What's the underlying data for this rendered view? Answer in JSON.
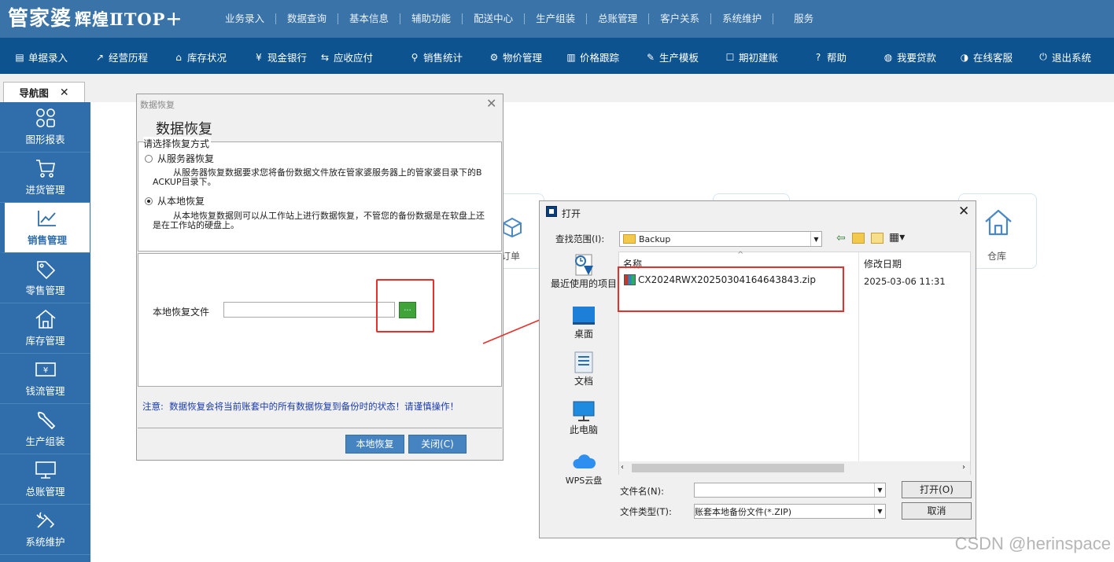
{
  "app": {
    "logo_main": "管家婆",
    "logo_sub": "辉煌ⅡTOP＋"
  },
  "top_menu": [
    "业务录入",
    "数据查询",
    "基本信息",
    "辅助功能",
    "配送中心",
    "生产组装",
    "总账管理",
    "客户关系",
    "系统维护",
    "服务"
  ],
  "toolbar": [
    {
      "label": "单据录入",
      "icon": "document-icon",
      "glyph": "▤"
    },
    {
      "label": "经营历程",
      "icon": "chart-line-icon",
      "glyph": "↗"
    },
    {
      "label": "库存状况",
      "icon": "home-icon",
      "glyph": "⌂"
    },
    {
      "label": "现金银行",
      "icon": "yen-icon",
      "glyph": "¥"
    },
    {
      "label": "应收应付",
      "icon": "exchange-icon",
      "glyph": "⇆"
    },
    {
      "label": "销售统计",
      "icon": "search-icon",
      "glyph": "⚲"
    },
    {
      "label": "物价管理",
      "icon": "gear-icon",
      "glyph": "⚙"
    },
    {
      "label": "价格跟踪",
      "icon": "bar-chart-icon",
      "glyph": "▥"
    },
    {
      "label": "生产模板",
      "icon": "wrench-icon",
      "glyph": "✎"
    },
    {
      "label": "期初建账",
      "icon": "edit-icon",
      "glyph": "☐"
    },
    {
      "label": "帮助",
      "icon": "help-icon",
      "glyph": "?"
    },
    {
      "label": "我要贷款",
      "icon": "moneybag-icon",
      "glyph": "◍"
    },
    {
      "label": "在线客服",
      "icon": "headset-icon",
      "glyph": "◑"
    },
    {
      "label": "退出系统",
      "icon": "power-icon",
      "glyph": "⏻"
    }
  ],
  "nav_tab": {
    "label": "导航图",
    "close": "✕"
  },
  "sidebar": [
    {
      "label": "图形报表",
      "icon": "grid-icon"
    },
    {
      "label": "进货管理",
      "icon": "cart-icon"
    },
    {
      "label": "销售管理",
      "icon": "trend-icon",
      "active": true
    },
    {
      "label": "零售管理",
      "icon": "tag-icon"
    },
    {
      "label": "库存管理",
      "icon": "warehouse-icon"
    },
    {
      "label": "钱流管理",
      "icon": "money-icon"
    },
    {
      "label": "生产组装",
      "icon": "wrench-icon"
    },
    {
      "label": "总账管理",
      "icon": "monitor-icon"
    },
    {
      "label": "系统维护",
      "icon": "tools-icon"
    }
  ],
  "bg_cards": {
    "order_label": "订单",
    "warehouse_label": "仓库"
  },
  "restore_dialog": {
    "window_title": "数据恢复",
    "heading": "数据恢复",
    "group_label": "请选择恢复方式",
    "options": [
      {
        "label": "从服务器恢复",
        "desc": "从服务器恢复数据要求您将备份数据文件放在管家婆服务器上的管家婆目录下的BACKUP目录下。",
        "checked": false
      },
      {
        "label": "从本地恢复",
        "desc": "从本地恢复数据则可以从工作站上进行数据恢复，不管您的备份数据是在软盘上还是在工作站的硬盘上。",
        "checked": true
      }
    ],
    "file_label": "本地恢复文件",
    "file_value": "",
    "browse_label": "...",
    "notice": "注意:  数据恢复会将当前账套中的所有数据恢复到备份时的状态！请谨慎操作！",
    "restore_button": "本地恢复",
    "close_button": "关闭(C)"
  },
  "open_dialog": {
    "title": "打开",
    "lookin_label": "查找范围(I):",
    "lookin_value": "Backup",
    "places": [
      {
        "label": "最近使用的项目",
        "icon": "recent-icon"
      },
      {
        "label": "桌面",
        "icon": "desktop-icon"
      },
      {
        "label": "文档",
        "icon": "documents-icon"
      },
      {
        "label": "此电脑",
        "icon": "computer-icon"
      },
      {
        "label": "WPS云盘",
        "icon": "cloud-icon"
      }
    ],
    "col_name": "名称",
    "col_date": "修改日期",
    "files": [
      {
        "name": "CX2024RWX20250304164643843.zip",
        "date": "2025-03-06 11:31"
      }
    ],
    "filename_label": "文件名(N):",
    "filename_value": "",
    "filetype_label": "文件类型(T):",
    "filetype_value": "账套本地备份文件(*.ZIP)",
    "open_button": "打开(O)",
    "cancel_button": "取消"
  },
  "watermark": "CSDN @herinspace",
  "colors": {
    "topbar": "#3a73a8",
    "toolbar": "#0d5390",
    "sidebar": "#2f6eab",
    "highlight": "#e8302a"
  }
}
